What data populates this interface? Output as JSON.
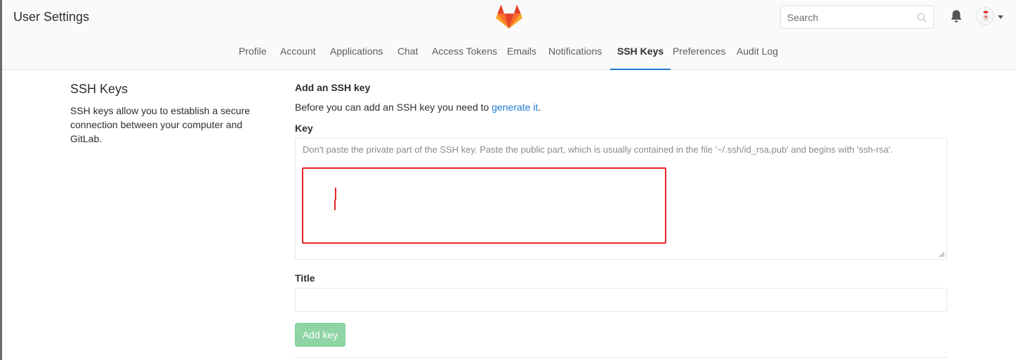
{
  "header": {
    "title": "User Settings",
    "search": {
      "placeholder": "Search",
      "value": ""
    },
    "icons": {
      "logo": "gitlab-tanuki-logo",
      "search": "search-icon",
      "notifications": "bell-icon",
      "avatar": "user-avatar",
      "menu": "caret-down-icon"
    }
  },
  "tabs": [
    {
      "label": "Profile",
      "active": false
    },
    {
      "label": "Account",
      "active": false
    },
    {
      "label": "Applications",
      "active": false
    },
    {
      "label": "Chat",
      "active": false
    },
    {
      "label": "Access Tokens",
      "active": false
    },
    {
      "label": "Emails",
      "active": false
    },
    {
      "label": "Notifications",
      "active": false
    },
    {
      "label": "SSH Keys",
      "active": true
    },
    {
      "label": "Preferences",
      "active": false
    },
    {
      "label": "Audit Log",
      "active": false
    }
  ],
  "sidebar": {
    "title": "SSH Keys",
    "description": "SSH keys allow you to establish a secure connection between your computer and GitLab."
  },
  "form": {
    "heading": "Add an SSH key",
    "intro_text": "Before you can add an SSH key you need to ",
    "intro_link": "generate it",
    "intro_suffix": ".",
    "key_label": "Key",
    "key_placeholder": "Don't paste the private part of the SSH key. Paste the public part, which is usually contained in the file '~/.ssh/id_rsa.pub' and begins with 'ssh-rsa'.",
    "key_value": "",
    "title_label": "Title",
    "title_value": "",
    "submit_label": "Add key"
  },
  "colors": {
    "accent": "#1f78d1",
    "success_disabled": "#8fd4a5",
    "annotation_red": "#e52323",
    "logo_orange": "#e24329",
    "logo_light": "#fca326"
  }
}
